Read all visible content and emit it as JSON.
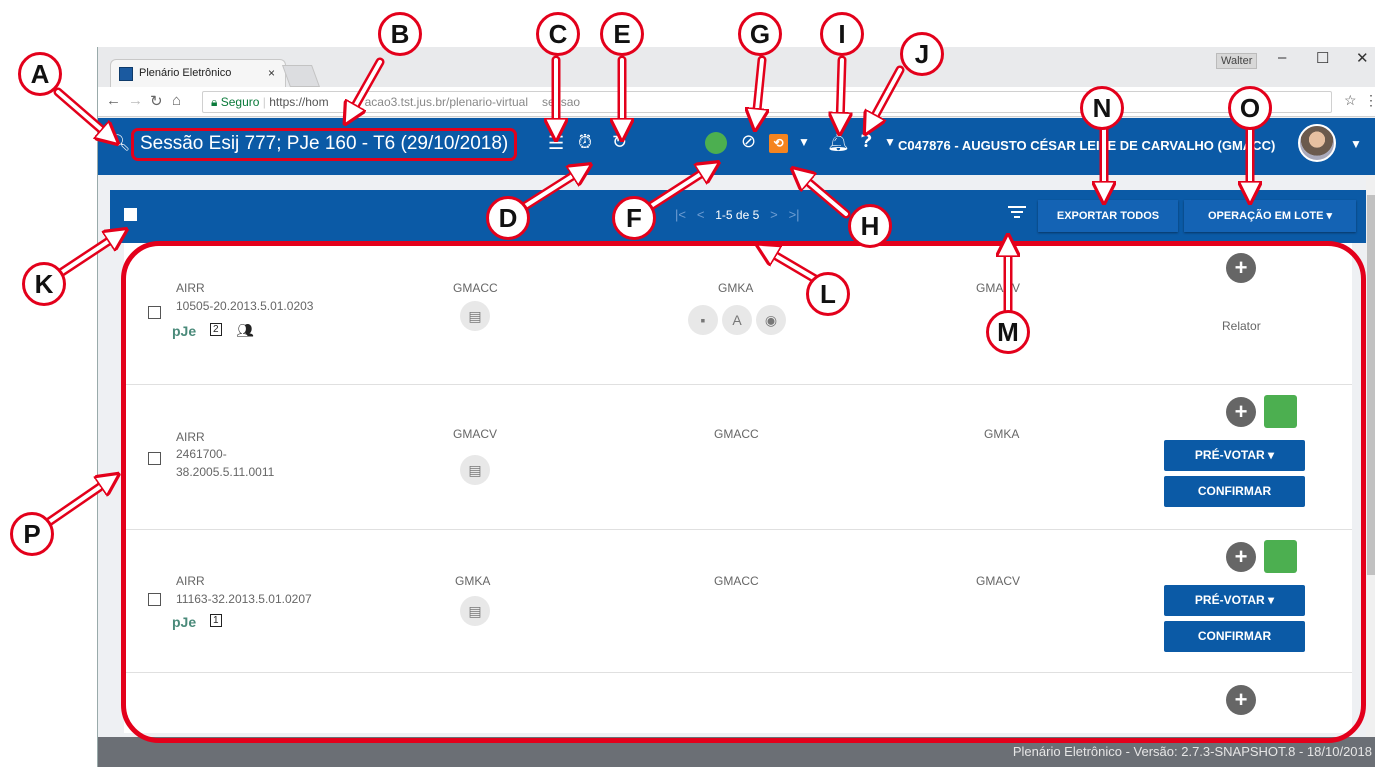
{
  "browser": {
    "tab_title": "Plenário Eletrônico",
    "tab_close": "×",
    "windows_user": "Walter",
    "secure_label": "Seguro",
    "url_prefix": "https://hom",
    "url_mid": "acao3.tst.jus.br/plenario-virtual",
    "url_suffix": "sessao"
  },
  "appbar": {
    "session_title": "Sessão Esij 777; PJe 160 - T6 (29/10/2018)",
    "user": "C047876 - AUGUSTO CÉSAR LEITE DE CARVALHO (GMACC)"
  },
  "toolbar": {
    "pager": "1-5 de 5",
    "export_all": "EXPORTAR TODOS",
    "batch_operation": "OPERAÇÃO EM LOTE"
  },
  "rows": [
    {
      "cls": "AIRR",
      "number": "10505-20.2013.5.01.0203",
      "c1": "GMACC",
      "c2": "GMKA",
      "c3": "GMACV",
      "role": "Relator",
      "pje": "pJe",
      "pje_count": "2"
    },
    {
      "cls": "AIRR",
      "number_a": "2461700-",
      "number_b": "38.2005.5.11.0011",
      "c1": "GMACV",
      "c2": "GMACC",
      "c3": "GMKA",
      "prevote": "PRÉ-VOTAR",
      "confirm": "CONFIRMAR"
    },
    {
      "cls": "AIRR",
      "number": "11163-32.2013.5.01.0207",
      "c1": "GMKA",
      "c2": "GMACC",
      "c3": "GMACV",
      "prevote": "PRÉ-VOTAR",
      "confirm": "CONFIRMAR",
      "pje": "pJe",
      "pje_count": "1"
    }
  ],
  "footer": "Plenário Eletrônico - Versão: 2.7.3-SNAPSHOT.8 - 18/10/2018",
  "callouts": [
    "A",
    "B",
    "C",
    "D",
    "E",
    "F",
    "G",
    "H",
    "I",
    "J",
    "K",
    "L",
    "M",
    "N",
    "O",
    "P"
  ],
  "colors": {
    "brand_blue": "#0b5aa6",
    "callout_red": "#e3001b",
    "status_green": "#4caf50",
    "orange": "#f5841f"
  }
}
